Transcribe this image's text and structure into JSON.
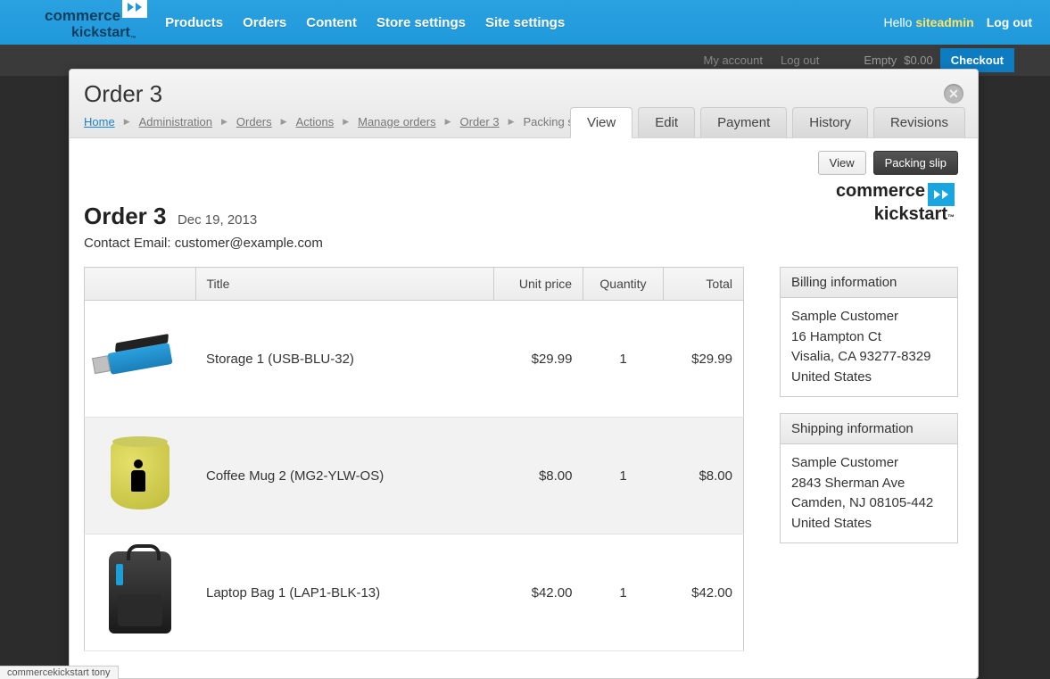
{
  "topnav": {
    "items": [
      "Products",
      "Orders",
      "Content",
      "Store settings",
      "Site settings"
    ],
    "hello_prefix": "Hello ",
    "username": "siteadmin",
    "logout": "Log out"
  },
  "subbar": {
    "my_account": "My account",
    "logout": "Log out",
    "empty": "Empty",
    "price": "$0.00",
    "checkout": "Checkout"
  },
  "modal": {
    "title": "Order 3",
    "breadcrumbs": [
      "Home",
      "Administration",
      "Orders",
      "Actions",
      "Manage orders",
      "Order 3",
      "Packing slip"
    ],
    "tabs": [
      "View",
      "Edit",
      "Payment",
      "History",
      "Revisions"
    ],
    "active_tab": 0,
    "actions": {
      "view": "View",
      "packing_slip": "Packing slip"
    }
  },
  "order": {
    "heading": "Order 3",
    "date": "Dec 19, 2013",
    "contact_label": "Contact Email: ",
    "contact_email": "customer@example.com"
  },
  "table": {
    "headers": {
      "image": "",
      "title": "Title",
      "unit_price": "Unit price",
      "quantity": "Quantity",
      "total": "Total"
    },
    "rows": [
      {
        "title": "Storage 1 (USB-BLU-32)",
        "unit_price": "$29.99",
        "quantity": "1",
        "total": "$29.99",
        "thumb": "usb"
      },
      {
        "title": "Coffee Mug 2 (MG2-YLW-OS)",
        "unit_price": "$8.00",
        "quantity": "1",
        "total": "$8.00",
        "thumb": "mug"
      },
      {
        "title": "Laptop Bag 1 (LAP1-BLK-13)",
        "unit_price": "$42.00",
        "quantity": "1",
        "total": "$42.00",
        "thumb": "bag"
      }
    ]
  },
  "billing": {
    "heading": "Billing information",
    "name": "Sample Customer",
    "street": "16 Hampton Ct",
    "citystate": "Visalia, CA 93277-8329",
    "country": "United States"
  },
  "shipping": {
    "heading": "Shipping information",
    "name": "Sample Customer",
    "street": "2843 Sherman Ave",
    "citystate": "Camden, NJ 08105-442",
    "country": "United States"
  },
  "status_text": "commercekickstart tony"
}
